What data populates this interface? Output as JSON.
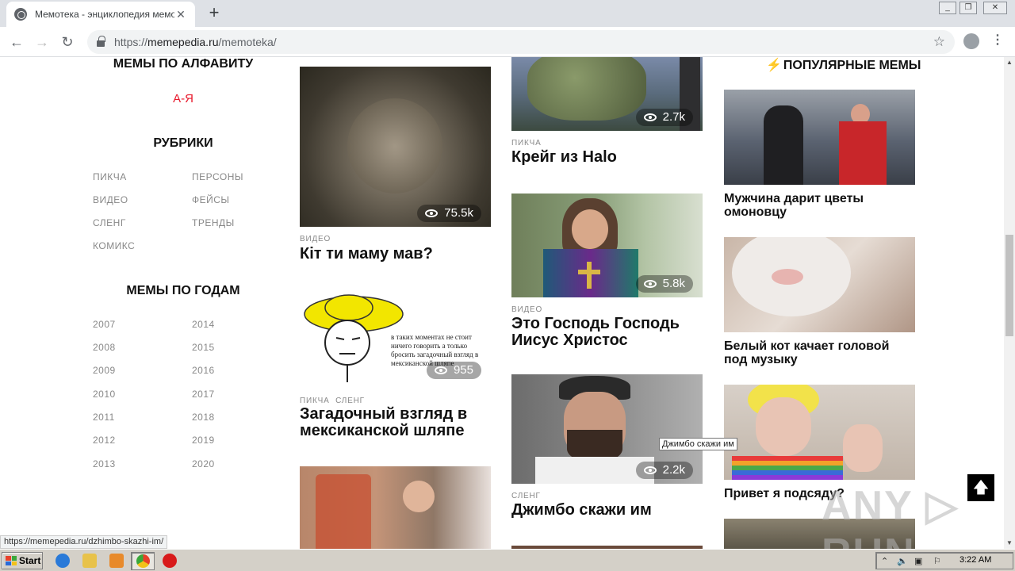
{
  "browser": {
    "tab_title": "Мемотека - энциклопедия мемов",
    "tab_close": "✕",
    "new_tab": "+",
    "url_scheme": "https://",
    "url_host": "memepedia.ru",
    "url_path": "/memoteka/",
    "status_url": "https://memepedia.ru/dzhimbo-skazhi-im/"
  },
  "sidebar": {
    "alphabet_heading": "МЕМЫ ПО АЛФАВИТУ",
    "alphabet_link": "А-Я",
    "rubrics_heading": "РУБРИКИ",
    "rubrics": [
      "ПИКЧА",
      "ПЕРСОНЫ",
      "ВИДЕО",
      "ФЕЙСЫ",
      "СЛЕНГ",
      "ТРЕНДЫ",
      "КОМИКС"
    ],
    "years_heading": "МЕМЫ ПО ГОДАМ",
    "years": [
      "2007",
      "2014",
      "2008",
      "2015",
      "2009",
      "2016",
      "2010",
      "2017",
      "2011",
      "2018",
      "2012",
      "2019",
      "2013",
      "2020"
    ]
  },
  "col1": {
    "cards": [
      {
        "category": "ВИДЕО",
        "title": "Кіт ти маму мав?",
        "views": "75.5k"
      },
      {
        "category": "ПИКЧА  СЛЕНГ",
        "title": "Загадочный взгляд в мексиканской шляпе",
        "views": "955",
        "image_text": "в таких моментах не стоит ничего говорить а только бросить загадочный взгляд в мексиканской шляпе"
      }
    ]
  },
  "col2": {
    "cards": [
      {
        "category": "ПИКЧА",
        "title": "Крейг из Halo",
        "views": "2.7k"
      },
      {
        "category": "ВИДЕО",
        "title": "Это Господь Господь Иисус Христос",
        "views": "5.8k"
      },
      {
        "category": "СЛЕНГ",
        "title": "Джимбо скажи им",
        "views": "2.2k"
      }
    ]
  },
  "popular": {
    "heading": "ПОПУЛЯРНЫЕ МЕМЫ",
    "bolt": "⚡",
    "items": [
      {
        "title": "Мужчина дарит цветы омоновцу"
      },
      {
        "title": "Белый кот качает головой под музыку"
      },
      {
        "title": "Привет я подсяду?"
      }
    ]
  },
  "tooltip": "Джимбо скажи им",
  "to_top": "🡅",
  "watermark": "ANY ▷ RUN",
  "taskbar": {
    "start_label": "Start",
    "clock": "3:22 AM"
  }
}
